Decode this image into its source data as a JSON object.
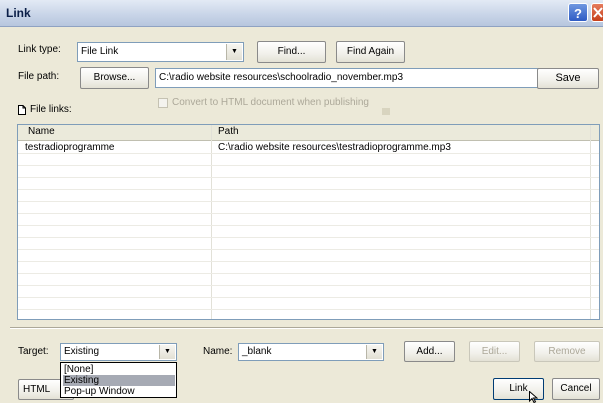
{
  "window": {
    "title": "Link",
    "help": "?"
  },
  "link_type": {
    "label": "Link type:",
    "value": "File Link"
  },
  "buttons": {
    "find": "Find...",
    "find_again": "Find Again",
    "browse": "Browse...",
    "save": "Save",
    "add": "Add...",
    "edit": "Edit...",
    "remove": "Remove",
    "html": "HTML",
    "link": "Link",
    "cancel": "Cancel"
  },
  "file_path": {
    "label": "File path:",
    "value": "C:\\radio website resources\\schoolradio_november.mp3"
  },
  "file_links": {
    "label": "File links:"
  },
  "convert": {
    "label": "Convert to HTML document when publishing",
    "checked": false
  },
  "table": {
    "columns": [
      "Name",
      "Path"
    ],
    "rows": [
      {
        "name": "testradioprogramme",
        "path": "C:\\radio website resources\\testradioprogramme.mp3"
      }
    ]
  },
  "target": {
    "label": "Target:",
    "value": "Existing",
    "options": [
      "[None]",
      "Existing",
      "Pop-up Window"
    ],
    "highlighted": "Existing"
  },
  "name_field": {
    "label": "Name:",
    "value": "_blank"
  }
}
